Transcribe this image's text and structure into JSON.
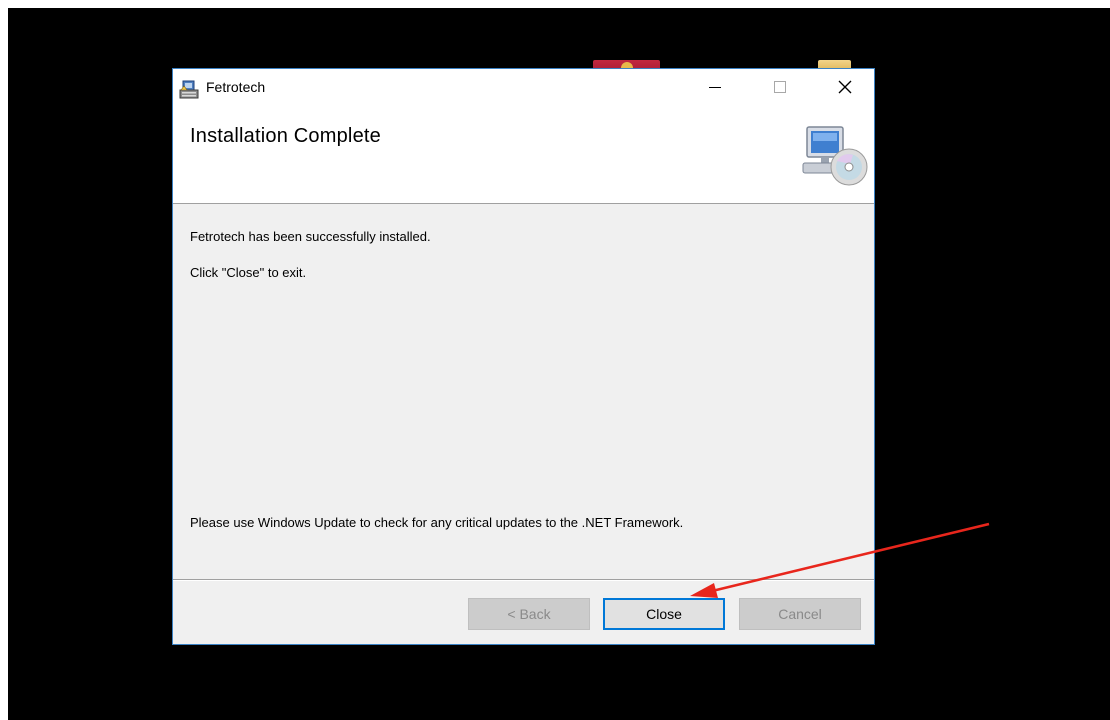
{
  "window": {
    "title": "Fetrotech",
    "app_icon": "installer-package-icon",
    "caption_buttons": {
      "minimize": "—",
      "maximize": "☐",
      "close": "✕"
    }
  },
  "header": {
    "title": "Installation Complete",
    "icon": "computer-cd-icon"
  },
  "body": {
    "success_message": "Fetrotech has been successfully installed.",
    "exit_message": "Click \"Close\" to exit.",
    "update_message": "Please use Windows Update to check for any critical updates to the .NET Framework."
  },
  "buttons": {
    "back": "< Back",
    "close": "Close",
    "cancel": "Cancel"
  },
  "colors": {
    "accent": "#0078d7",
    "annotation_arrow": "#e8261c"
  }
}
